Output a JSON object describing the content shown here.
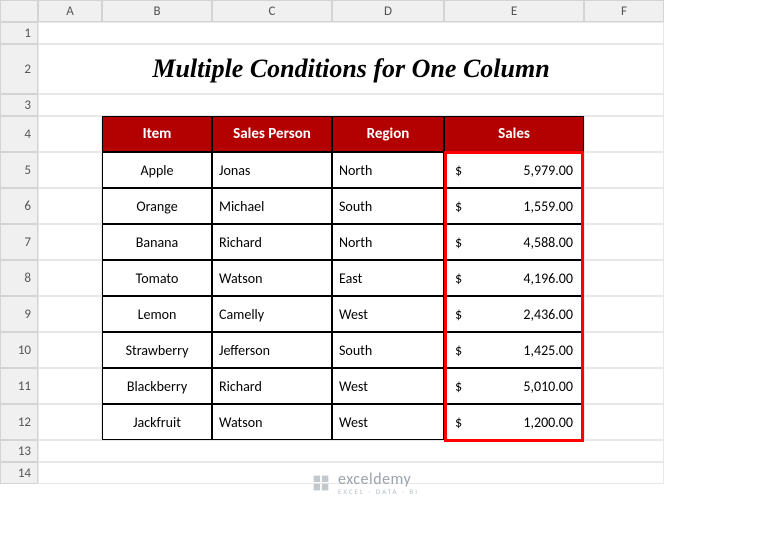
{
  "columns": [
    "A",
    "B",
    "C",
    "D",
    "E",
    "F"
  ],
  "rows": [
    "1",
    "2",
    "3",
    "4",
    "5",
    "6",
    "7",
    "8",
    "9",
    "10",
    "11",
    "12",
    "13",
    "14"
  ],
  "title": "Multiple Conditions for One Column",
  "headers": {
    "item": "Item",
    "sales_person": "Sales Person",
    "region": "Region",
    "sales": "Sales"
  },
  "data": [
    {
      "item": "Apple",
      "person": "Jonas",
      "region": "North",
      "sales": "5,979.00"
    },
    {
      "item": "Orange",
      "person": "Michael",
      "region": "South",
      "sales": "1,559.00"
    },
    {
      "item": "Banana",
      "person": "Richard",
      "region": "North",
      "sales": "4,588.00"
    },
    {
      "item": "Tomato",
      "person": "Watson",
      "region": "East",
      "sales": "4,196.00"
    },
    {
      "item": "Lemon",
      "person": "Camelly",
      "region": "West",
      "sales": "2,436.00"
    },
    {
      "item": "Strawberry",
      "person": "Jefferson",
      "region": "South",
      "sales": "1,425.00"
    },
    {
      "item": "Blackberry",
      "person": "Richard",
      "region": "West",
      "sales": "5,010.00"
    },
    {
      "item": "Jackfruit",
      "person": "Watson",
      "region": "West",
      "sales": "1,200.00"
    }
  ],
  "currency": "$",
  "watermark": {
    "brand": "exceldemy",
    "tagline": "EXCEL · DATA · BI"
  },
  "chart_data": {
    "type": "table",
    "title": "Multiple Conditions for One Column",
    "columns": [
      "Item",
      "Sales Person",
      "Region",
      "Sales"
    ],
    "rows": [
      [
        "Apple",
        "Jonas",
        "North",
        5979.0
      ],
      [
        "Orange",
        "Michael",
        "South",
        1559.0
      ],
      [
        "Banana",
        "Richard",
        "North",
        4588.0
      ],
      [
        "Tomato",
        "Watson",
        "East",
        4196.0
      ],
      [
        "Lemon",
        "Camelly",
        "West",
        2436.0
      ],
      [
        "Strawberry",
        "Jefferson",
        "South",
        1425.0
      ],
      [
        "Blackberry",
        "Richard",
        "West",
        5010.0
      ],
      [
        "Jackfruit",
        "Watson",
        "West",
        1200.0
      ]
    ]
  }
}
